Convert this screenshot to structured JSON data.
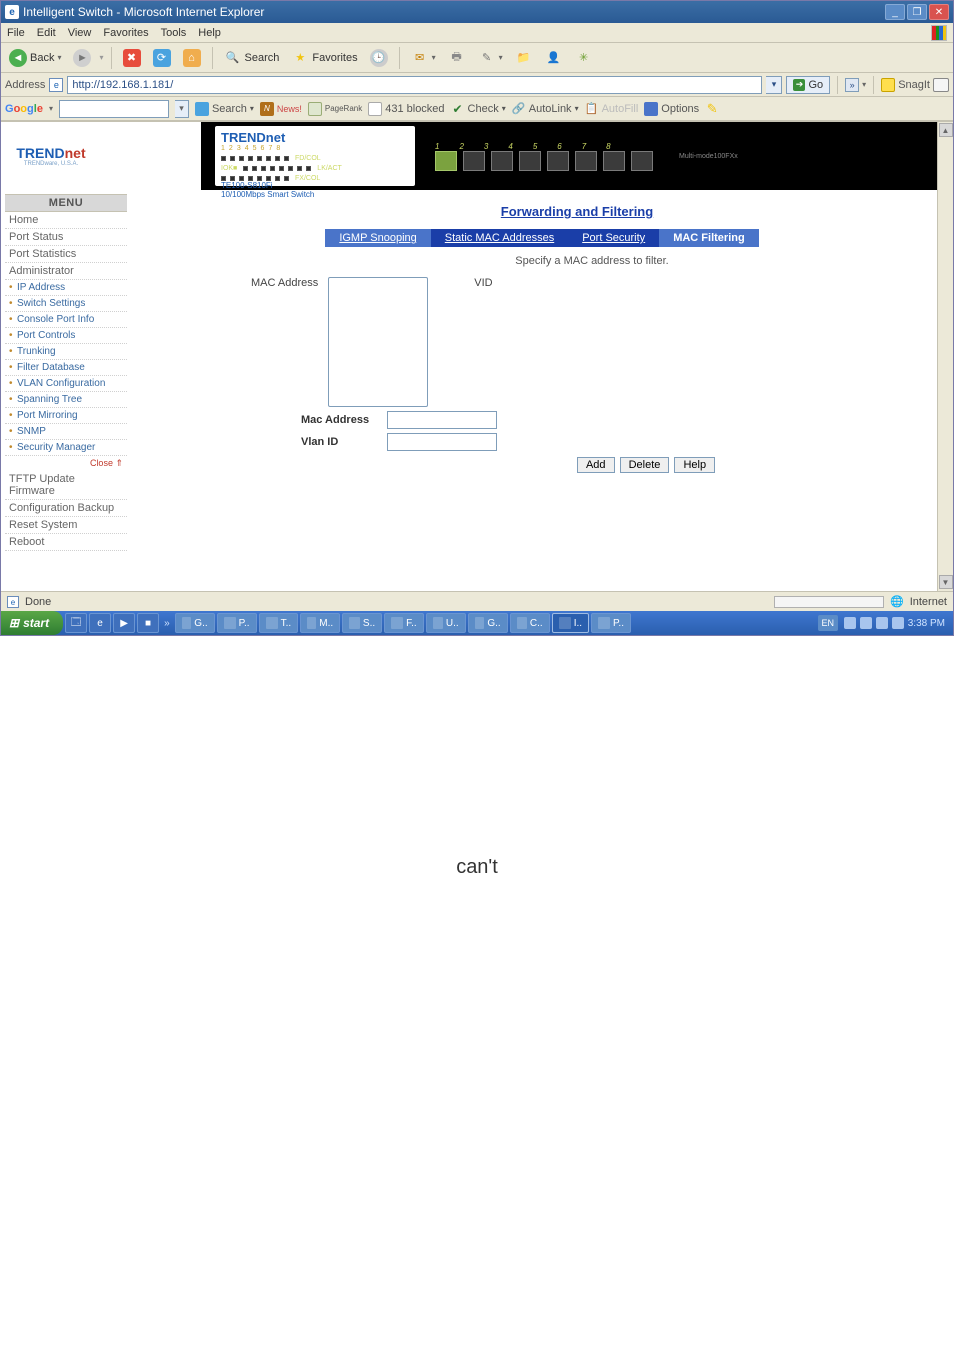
{
  "window": {
    "title": "Intelligent Switch - Microsoft Internet Explorer"
  },
  "menubar": [
    "File",
    "Edit",
    "View",
    "Favorites",
    "Tools",
    "Help"
  ],
  "stdbar": {
    "back": "Back",
    "search": "Search",
    "favorites": "Favorites"
  },
  "address": {
    "label": "Address",
    "url": "http://192.168.1.181/",
    "go": "Go",
    "snagit": "SnagIt"
  },
  "google": {
    "search": "Search",
    "news": "News!",
    "pagerank": "PageRank",
    "blocked": "431 blocked",
    "check": "Check",
    "autolink": "AutoLink",
    "autofill": "AutoFill",
    "options": "Options"
  },
  "brand": {
    "trend": "TREND",
    "net": "net",
    "tag": "TRENDware, U.S.A."
  },
  "device": {
    "brand": "TRENDnet",
    "model1": "TE100-S810Fi",
    "model2": "10/100Mbps Smart Switch",
    "led_idx": [
      "1",
      "2",
      "3",
      "4",
      "5",
      "6",
      "7",
      "8"
    ],
    "leds": [
      "FD/COL",
      "LK/ACT",
      "FX/COL"
    ],
    "port_idx": [
      "1",
      "2",
      "3",
      "4",
      "5",
      "6",
      "7",
      "8"
    ],
    "fiber": "Multi-mode100FXx"
  },
  "sidebar": {
    "menu": "MENU",
    "home": "Home",
    "port_status": "Port Status",
    "port_stats": "Port Statistics",
    "admin": "Administrator",
    "subs": [
      "IP Address",
      "Switch Settings",
      "Console Port Info",
      "Port Controls",
      "Trunking",
      "Filter Database",
      "VLAN Configuration",
      "Spanning Tree",
      "Port Mirroring",
      "SNMP",
      "Security Manager"
    ],
    "close": "Close",
    "tftp": "TFTP Update Firmware",
    "cfg": "Configuration Backup",
    "reset": "Reset System",
    "reboot": "Reboot"
  },
  "page": {
    "heading": "Forwarding and Filtering",
    "tabs": {
      "igmp": "IGMP Snooping",
      "static": "Static MAC Addresses",
      "security": "Port Security",
      "mac": "MAC Filtering"
    },
    "instr": "Specify a MAC address to filter.",
    "mac_label": "MAC Address",
    "vid_label": "VID",
    "field_mac": "Mac Address",
    "field_vlan": "Vlan ID",
    "btn_add": "Add",
    "btn_delete": "Delete",
    "btn_help": "Help"
  },
  "status": {
    "done": "Done",
    "zone": "Internet"
  },
  "taskbar": {
    "start": "start",
    "tasks": [
      "G..",
      "P..",
      "T..",
      "M..",
      "S..",
      "F..",
      "U..",
      "G..",
      "C..",
      "I..",
      "P.."
    ],
    "time": "3:38 PM"
  },
  "stray": "can't"
}
